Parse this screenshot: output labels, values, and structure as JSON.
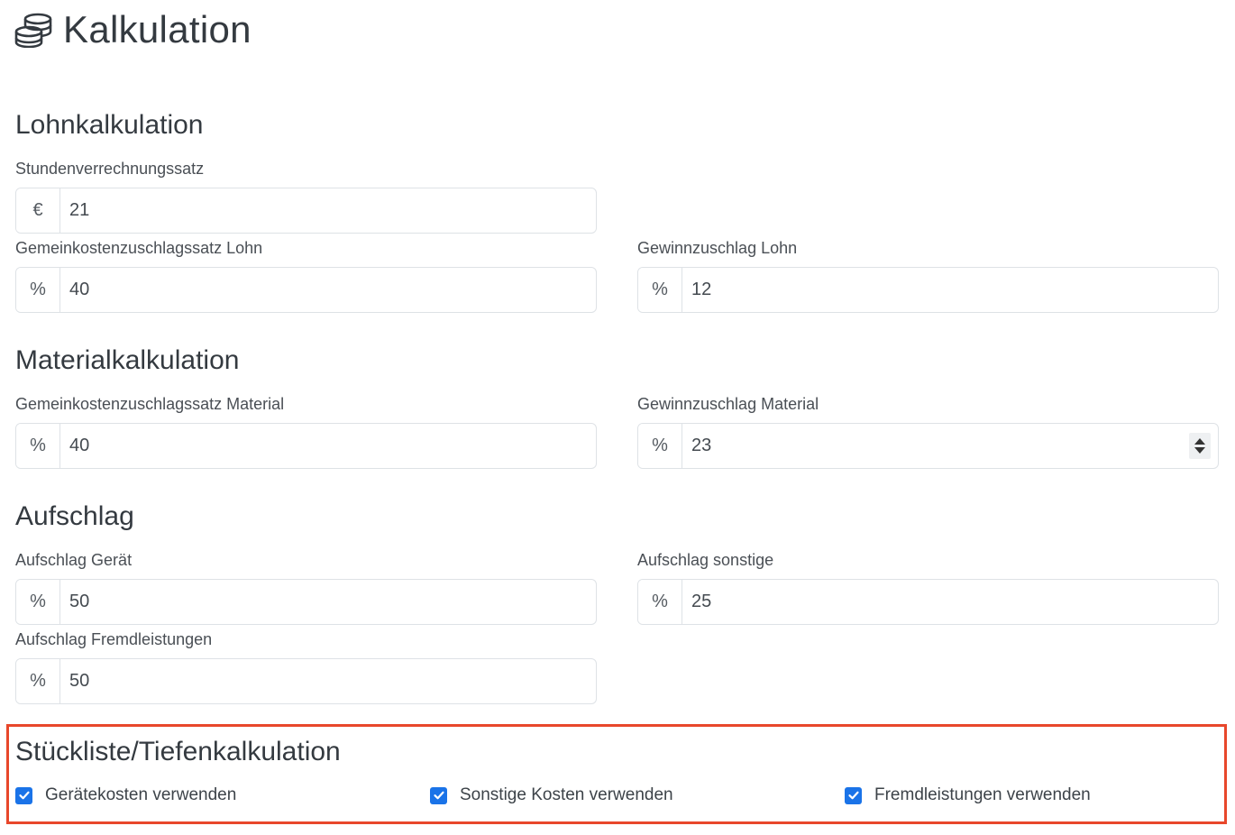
{
  "page": {
    "title": "Kalkulation",
    "icon": "coins-icon"
  },
  "sections": {
    "lohn": {
      "title": "Lohnkalkulation",
      "stundensatz": {
        "label": "Stundenverrechnungssatz",
        "addon": "€",
        "value": "21"
      },
      "gemeinkosten": {
        "label": "Gemeinkostenzuschlagssatz Lohn",
        "addon": "%",
        "value": "40"
      },
      "gewinn": {
        "label": "Gewinnzuschlag Lohn",
        "addon": "%",
        "value": "12"
      }
    },
    "material": {
      "title": "Materialkalkulation",
      "gemeinkosten": {
        "label": "Gemeinkostenzuschlagssatz Material",
        "addon": "%",
        "value": "40"
      },
      "gewinn": {
        "label": "Gewinnzuschlag Material",
        "addon": "%",
        "value": "23"
      }
    },
    "aufschlag": {
      "title": "Aufschlag",
      "geraet": {
        "label": "Aufschlag Gerät",
        "addon": "%",
        "value": "50"
      },
      "sonstige": {
        "label": "Aufschlag sonstige",
        "addon": "%",
        "value": "25"
      },
      "fremd": {
        "label": "Aufschlag Fremdleistungen",
        "addon": "%",
        "value": "50"
      }
    },
    "stueckliste": {
      "title": "Stückliste/Tiefenkalkulation",
      "checkboxes": [
        {
          "label": "Gerätekosten verwenden",
          "checked": true
        },
        {
          "label": "Sonstige Kosten verwenden",
          "checked": true
        },
        {
          "label": "Fremdleistungen verwenden",
          "checked": true
        }
      ]
    }
  },
  "colors": {
    "checkbox": "#1a73e8",
    "highlight": "#e8472b",
    "border": "#dee2e6"
  }
}
